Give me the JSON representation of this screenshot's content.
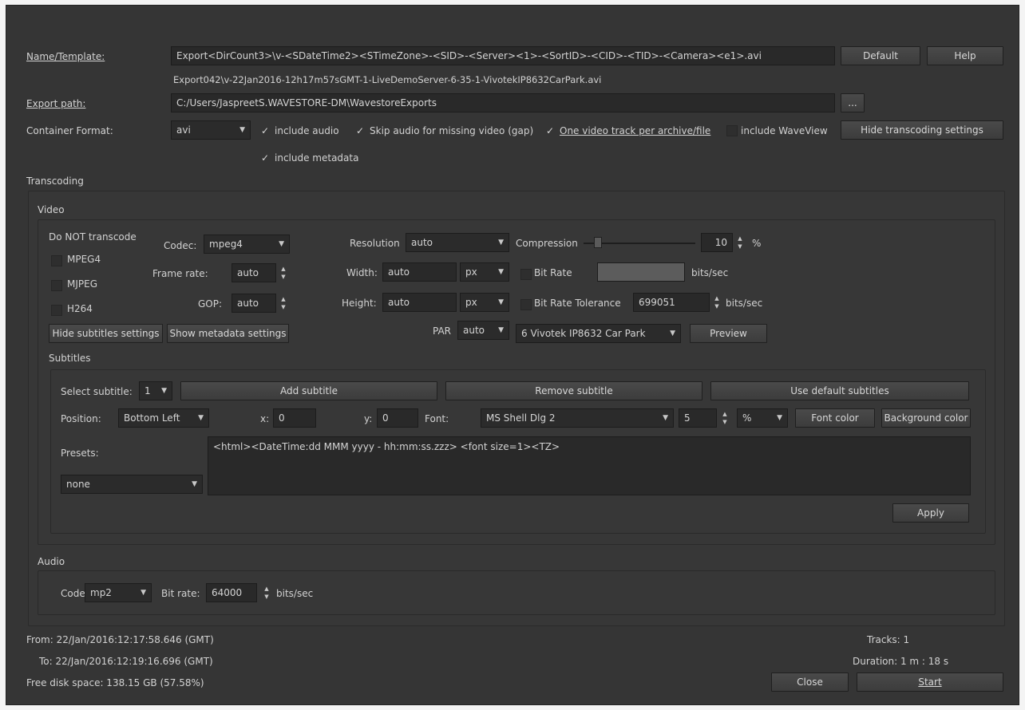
{
  "name_template": {
    "label": "Name/Template:",
    "value": "Export<DirCount3>\\v-<SDateTime2><STimeZone>-<SID>-<Server><1>-<SortID>-<CID>-<TID>-<Camera><e1>.avi",
    "preview": "Export042\\v-22Jan2016-12h17m57sGMT-1-LiveDemoServer-6-35-1-VivotekIP8632CarPark.avi",
    "default_label": "Default",
    "help_label": "Help"
  },
  "export_path": {
    "label": "Export path:",
    "value": "C:/Users/JaspreetS.WAVESTORE-DM\\WavestoreExports",
    "browse_label": "..."
  },
  "container": {
    "label": "Container Format:",
    "format": "avi",
    "include_audio": "include audio",
    "skip_audio": "Skip audio for missing video (gap)",
    "one_track": "One video track per archive/file",
    "include_waveview": "include WaveView",
    "include_metadata": "include metadata",
    "hide_transcoding_label": "Hide transcoding settings"
  },
  "transcoding": {
    "title": "Transcoding"
  },
  "video": {
    "title": "Video",
    "do_not_transcode": "Do NOT transcode",
    "mpeg4": "MPEG4",
    "mjpeg": "MJPEG",
    "h264": "H264",
    "codec_label": "Codec:",
    "codec": "mpeg4",
    "frame_rate_label": "Frame rate:",
    "frame_rate": "auto",
    "gop_label": "GOP:",
    "gop": "auto",
    "resolution_label": "Resolution",
    "resolution": "auto",
    "width_label": "Width:",
    "width": "auto",
    "height_label": "Height:",
    "height": "auto",
    "px1": "px",
    "px2": "px",
    "par_label": "PAR",
    "par": "auto",
    "compression_label": "Compression",
    "compression": "10",
    "percent": "%",
    "bitrate_label": "Bit Rate",
    "bitrate_unit": "bits/sec",
    "bitrate_tol_label": "Bit Rate Tolerance",
    "bitrate_tol": "699051",
    "bitrate_tol_unit": "bits/sec",
    "camera": "6 Vivotek IP8632 Car Park",
    "preview_label": "Preview",
    "hide_subtitles_label": "Hide subtitles settings",
    "show_metadata_label": "Show metadata settings"
  },
  "subtitles": {
    "title": "Subtitles",
    "select_label": "Select subtitle:",
    "select_value": "1",
    "add_label": "Add subtitle",
    "remove_label": "Remove subtitle",
    "default_label": "Use default subtitles",
    "position_label": "Position:",
    "position": "Bottom Left",
    "x_label": "x:",
    "x": "0",
    "y_label": "y:",
    "y": "0",
    "font_label": "Font:",
    "font": "MS Shell Dlg 2",
    "font_size": "5",
    "size_unit": "%",
    "font_color_label": "Font color",
    "bg_color_label": "Background color",
    "presets_label": "Presets:",
    "preset": "none",
    "text": "<html><DateTime:dd MMM yyyy - hh:mm:ss.zzz> <font size=1><TZ>",
    "apply_label": "Apply"
  },
  "audio": {
    "title": "Audio",
    "codec_label": "Codec",
    "codec": "mp2",
    "bitrate_label": "Bit rate:",
    "bitrate": "64000",
    "unit": "bits/sec"
  },
  "footer": {
    "from": "From:  22/Jan/2016:12:17:58.646 (GMT)",
    "to": "To:  22/Jan/2016:12:19:16.696 (GMT)",
    "free": "Free disk space:  138.15 GB (57.58%)",
    "tracks": "Tracks:  1",
    "duration": "Duration:  1 m : 18 s",
    "close_label": "Close",
    "start_label": "Start"
  },
  "colors": {
    "window_bg": "#353535",
    "field_bg": "#292929",
    "text": "#d4d4d4"
  }
}
